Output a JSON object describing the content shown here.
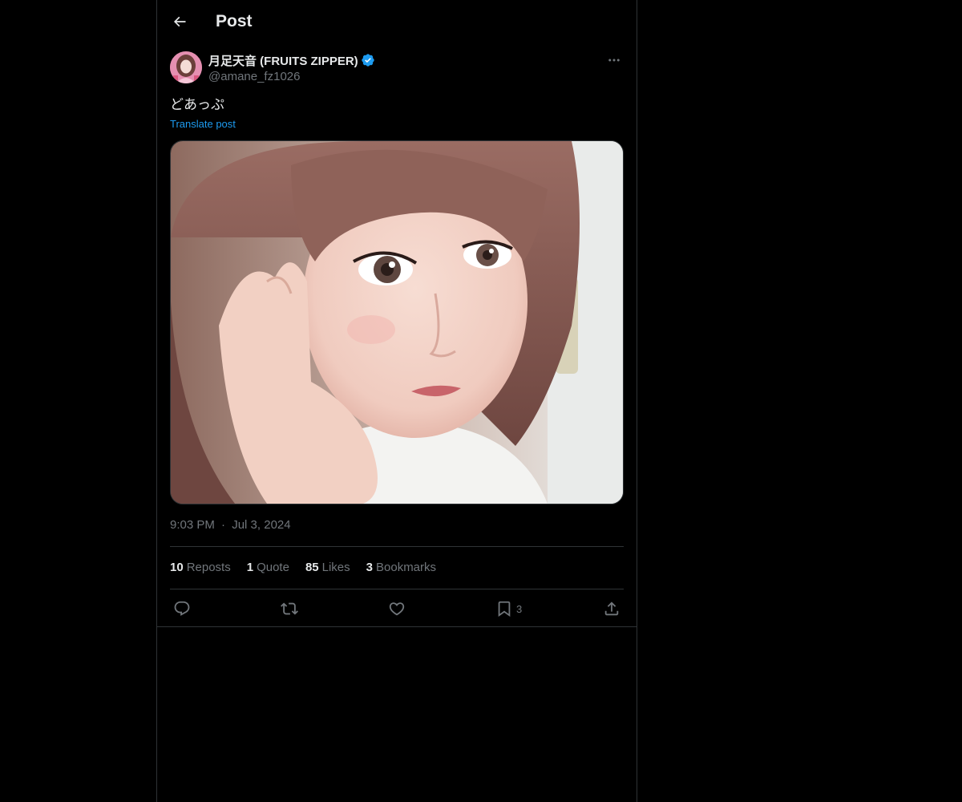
{
  "header": {
    "back_label": "Back",
    "title": "Post"
  },
  "post": {
    "author": {
      "display_name": "月足天音 (FRUITS ZIPPER)",
      "handle": "@amane_fz1026",
      "verified": true
    },
    "text": "どあっぷ",
    "translate_label": "Translate post",
    "time": "9:03 PM",
    "separator": "·",
    "date": "Jul 3, 2024",
    "stats": [
      {
        "count": "10",
        "label": "Reposts"
      },
      {
        "count": "1",
        "label": "Quote"
      },
      {
        "count": "85",
        "label": "Likes"
      },
      {
        "count": "3",
        "label": "Bookmarks"
      }
    ],
    "actions": {
      "reply_icon": "reply-icon",
      "repost_icon": "repost-icon",
      "like_icon": "heart-icon",
      "bookmark_icon": "bookmark-icon",
      "bookmark_count": "3",
      "share_icon": "share-icon"
    }
  },
  "colors": {
    "background": "#000000",
    "text_primary": "#e7e9ea",
    "text_secondary": "#71767b",
    "accent": "#1d9bf0",
    "border": "#2f3336"
  }
}
